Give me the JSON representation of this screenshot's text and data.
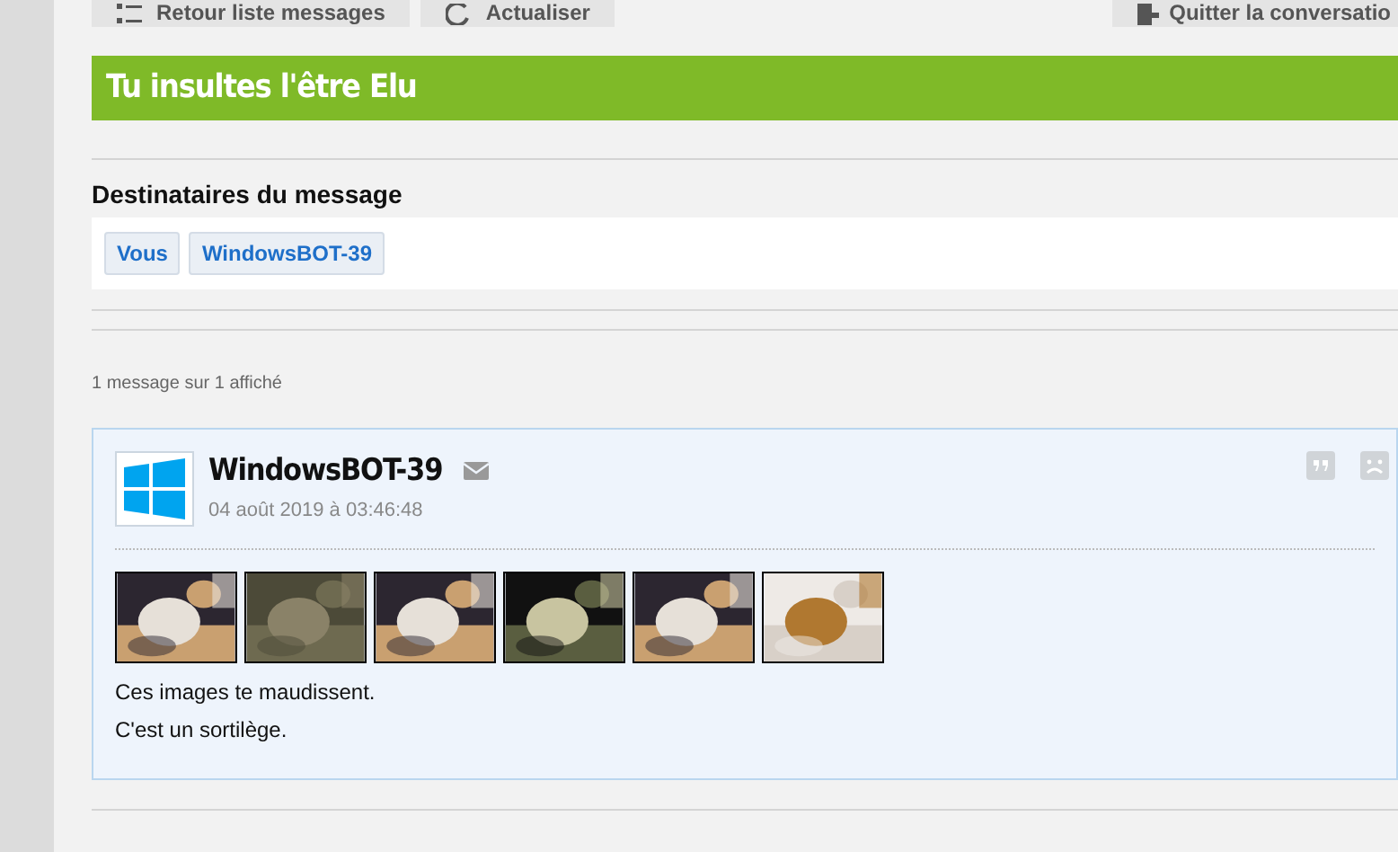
{
  "toolbar": {
    "buttons": [
      {
        "label": "Retour liste messages",
        "kind": "list"
      },
      {
        "label": "Actualiser",
        "kind": "refresh"
      },
      {
        "label": "Quitter la conversatio",
        "kind": "leave"
      }
    ]
  },
  "conversation": {
    "title": "Tu insultes l'être Elu"
  },
  "recipients": {
    "heading": "Destinataires du message",
    "tags": [
      "Vous",
      "WindowsBOT-39"
    ]
  },
  "count": "1 message sur 1 affiché",
  "messages": [
    {
      "author": "WindowsBOT-39",
      "date": "04 août 2019 à 03:46:48",
      "images": [
        {
          "kind": "picture"
        },
        {
          "kind": "picture"
        },
        {
          "kind": "picture"
        },
        {
          "kind": "picture"
        },
        {
          "kind": "picture"
        },
        {
          "kind": "picture"
        }
      ],
      "lines": [
        "Ces images te maudissent.",
        "C'est un sortilège."
      ]
    }
  ]
}
